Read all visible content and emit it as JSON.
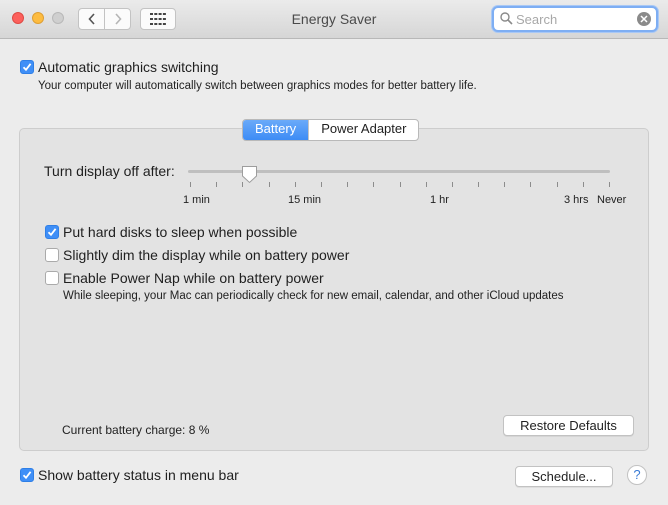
{
  "window": {
    "title": "Energy Saver"
  },
  "search": {
    "placeholder": "Search",
    "value": ""
  },
  "icons": {
    "back": "chevron-left-icon",
    "forward": "chevron-right-icon",
    "show_all": "grid-icon",
    "search": "magnifier-icon",
    "clear": "clear-icon"
  },
  "options": {
    "auto_graphics": {
      "label": "Automatic graphics switching",
      "checked": true,
      "description": "Your computer will automatically switch between graphics modes for better battery life."
    }
  },
  "tabs": [
    {
      "label": "Battery",
      "selected": true
    },
    {
      "label": "Power Adapter",
      "selected": false
    }
  ],
  "slider": {
    "label": "Turn display off after:",
    "tick_labels": [
      "1 min",
      "15 min",
      "1 hr",
      "3 hrs",
      "Never"
    ],
    "value_fraction": 0.145
  },
  "battery_options": [
    {
      "label": "Put hard disks to sleep when possible",
      "checked": true
    },
    {
      "label": "Slightly dim the display while on battery power",
      "checked": false
    },
    {
      "label": "Enable Power Nap while on battery power",
      "checked": false,
      "description": "While sleeping, your Mac can periodically check for new email, calendar, and other iCloud updates"
    }
  ],
  "status": {
    "battery_charge": "Current battery charge: 8 %"
  },
  "buttons": {
    "restore_defaults": "Restore Defaults",
    "schedule": "Schedule...",
    "help": "?"
  },
  "menu_bar_option": {
    "label": "Show battery status in menu bar",
    "checked": true
  },
  "colors": {
    "accent": "#3f8ff7",
    "close": "#fc605c",
    "minimize": "#fdbc40"
  }
}
